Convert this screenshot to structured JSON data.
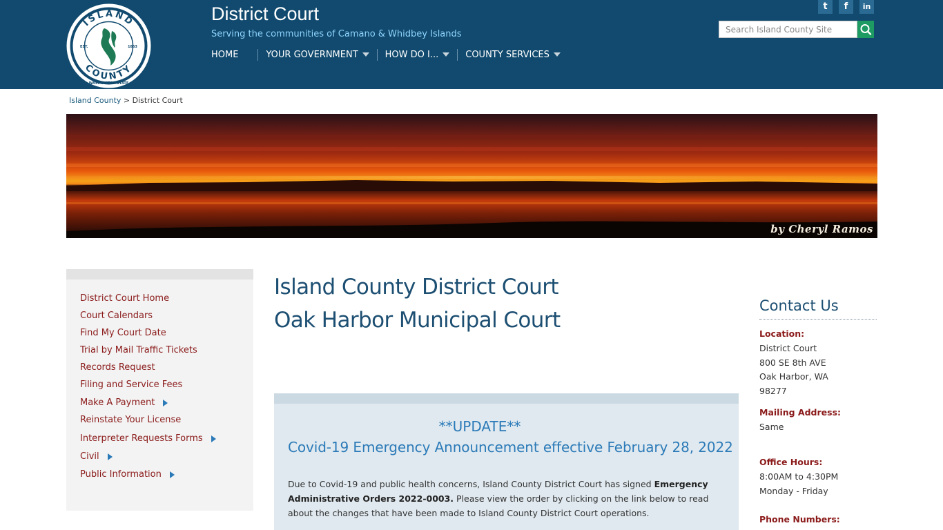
{
  "header": {
    "title": "District Court",
    "tagline": "Serving the communities of Camano & Whidbey Islands",
    "logo": {
      "top_text": "ISLAND",
      "bottom_text": "COUNTY",
      "state_text": "WASHINGTON STATE",
      "est_label": "EST.",
      "est_year": "1853"
    },
    "social": [
      {
        "name": "twitter-icon",
        "glyph": "t"
      },
      {
        "name": "facebook-icon",
        "glyph": "f"
      },
      {
        "name": "linkedin-icon",
        "glyph": "in"
      }
    ],
    "search": {
      "placeholder": "Search Island County Site"
    }
  },
  "nav": [
    {
      "label": "HOME",
      "dropdown": false
    },
    {
      "label": "YOUR GOVERNMENT",
      "dropdown": true
    },
    {
      "label": "HOW DO I...",
      "dropdown": true
    },
    {
      "label": "COUNTY SERVICES",
      "dropdown": true
    }
  ],
  "breadcrumb": {
    "root": "Island County",
    "separator": ">",
    "current": "District Court"
  },
  "banner": {
    "credit": "by Cheryl Ramos"
  },
  "sidebar": {
    "items": [
      {
        "label": "District Court Home",
        "submenu": false
      },
      {
        "label": "Court Calendars",
        "submenu": false
      },
      {
        "label": "Find My Court Date",
        "submenu": false
      },
      {
        "label": "Trial by Mail Traffic Tickets",
        "submenu": false
      },
      {
        "label": "Records Request",
        "submenu": false
      },
      {
        "label": "Filing and Service Fees",
        "submenu": false
      },
      {
        "label": "Make A Payment",
        "submenu": true
      },
      {
        "label": "Reinstate Your License",
        "submenu": false
      },
      {
        "label": "Interpreter Requests Forms",
        "submenu": true
      },
      {
        "label": "Civil",
        "submenu": true
      },
      {
        "label": "Public Information",
        "submenu": true
      }
    ]
  },
  "main": {
    "title_line1": "Island County District Court",
    "title_line2": "Oak Harbor Municipal Court",
    "announcement": {
      "update": "**UPDATE**",
      "headline": "Covid-19 Emergency Announcement effective February 28, 2022",
      "body_pre": "Due to Covid-19 and public health concerns, Island County District Court has signed ",
      "body_bold": "Emergency Administrative Orders 2022-0003.",
      "body_post": "  Please view the order by clicking on the link below to read about the changes that have been made to Island County District Court operations."
    }
  },
  "contact": {
    "title": "Contact Us",
    "location_label": "Location:",
    "location_lines": [
      "District Court",
      "800 SE 8th AVE",
      "Oak Harbor, WA",
      "98277"
    ],
    "mailing_label": "Mailing Address:",
    "mailing_value": "Same",
    "hours_label": "Office Hours:",
    "hours_lines": [
      "8:00AM to 4:30PM",
      "Monday - Friday"
    ],
    "phone_label": "Phone Numbers:"
  },
  "colors": {
    "header_bg": "#114a6e",
    "tagline": "#8fd4ff",
    "title_blue": "#1d4f72",
    "link_red": "#8b1a1a",
    "accent_blue": "#2b7ab8",
    "search_green": "#1e9a63"
  }
}
